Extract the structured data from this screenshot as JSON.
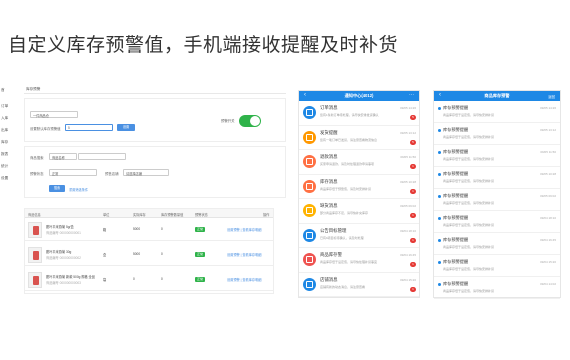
{
  "headline": "自定义库存预警值，手机端接收提醒及时补货",
  "desktop": {
    "left_nav": [
      "首",
      "订单",
      "入库",
      "出库",
      "库存",
      "报表",
      "统计",
      "设置"
    ],
    "breadcrumb": "库存预警",
    "scope_select": "一件商品仓",
    "warn_value_label": "设置默认库存预警值",
    "warn_value_input": "5",
    "confirm_button": "设置",
    "toggle_label": "预警开关",
    "filter": {
      "keyword_label": "商品搜索",
      "keyword_select": "商品名称",
      "status_label": "预警状态",
      "status_select": "正常",
      "store_label": "预售店铺",
      "store_select": "请选择店铺",
      "search_button": "搜索",
      "reset_link": "重置筛选条件"
    },
    "table": {
      "headers": [
        "商品信息",
        "单位",
        "实际库存",
        "库存预警数量值",
        "预警状态",
        "操作"
      ],
      "rows": [
        {
          "name": "脱叶平米燕菊 5g/盒",
          "code": "商品编号 000000000001",
          "unit": "箱",
          "stock": "5000",
          "warn": "0",
          "status": "正常",
          "ops": "设置预警 | 查看库存明细"
        },
        {
          "name": "脱叶平米燕菊 30g",
          "code": "商品编号 000000000002",
          "unit": "盒",
          "stock": "5000",
          "warn": "0",
          "status": "正常",
          "ops": "设置预警 | 查看库存明细"
        },
        {
          "name": "脱叶平米燕菊 新款 500g 规格 全品",
          "code": "商品编号 000000000003",
          "unit": "袋",
          "stock": "0",
          "warn": "0",
          "status": "正常",
          "ops": "设置预警 | 查看库存明细"
        }
      ]
    }
  },
  "phone1": {
    "title": "通知中心(4012)",
    "back": "‹",
    "more": "···",
    "items": [
      {
        "title": "订单消息",
        "text": "您有1条新订单待处理，请尽快安排发货确认",
        "time": "09/05 14:26",
        "badge": "5",
        "color": "#1e88e5"
      },
      {
        "title": "发货提醒",
        "text": "您有一笔订单已发货，请注意查看物流信息",
        "time": "09/05 13:12",
        "badge": "5",
        "color": "#ff9800"
      },
      {
        "title": "退款消息",
        "text": "买家申请退款，请及时处理退款申请事项",
        "time": "09/05 11:50",
        "badge": "1",
        "color": "#ff7043"
      },
      {
        "title": "库存消息",
        "text": "商品库存低于预警值，请及时安排补货",
        "time": "09/05 10:28",
        "badge": "1",
        "color": "#ff7043"
      },
      {
        "title": "缺货消息",
        "text": "部分商品库存不足，请尽快补充库存",
        "time": "09/05 09:02",
        "badge": "1",
        "color": "#ffb300"
      },
      {
        "title": "公告目标管理",
        "text": "已有9项目标待确认，请及时处理",
        "time": "09/04 18:10",
        "badge": "1",
        "color": "#1e88e5"
      },
      {
        "title": "商品库存警",
        "text": "商品库存低于设定值，请尽快处理补货事宜",
        "time": "09/04 16:45",
        "badge": "1",
        "color": "#ef5350"
      },
      {
        "title": "店铺消息",
        "text": "店铺有新的动态消息，请注意查看",
        "time": "09/04 15:20",
        "badge": "1",
        "color": "#1e88e5"
      }
    ]
  },
  "phone2": {
    "title": "商品库存预警",
    "back": "‹",
    "action": "返回",
    "items": [
      {
        "title": "库存预警提醒",
        "text": "商品库存低于设定值，请尽快安排补货",
        "time": "09/05 14:26"
      },
      {
        "title": "库存预警提醒",
        "text": "商品库存低于设定值，请尽快安排补货",
        "time": "09/05 13:12"
      },
      {
        "title": "库存预警提醒",
        "text": "商品库存低于设定值，请尽快安排补货",
        "time": "09/05 11:50"
      },
      {
        "title": "库存预警提醒",
        "text": "商品库存低于设定值，请尽快安排补货",
        "time": "09/05 10:28"
      },
      {
        "title": "库存预警提醒",
        "text": "商品库存低于设定值，请尽快安排补货",
        "time": "09/05 09:02"
      },
      {
        "title": "库存预警提醒",
        "text": "商品库存低于设定值，请尽快安排补货",
        "time": "09/04 18:10"
      },
      {
        "title": "库存预警提醒",
        "text": "商品库存低于设定值，请尽快安排补货",
        "time": "09/04 16:45"
      },
      {
        "title": "库存预警提醒",
        "text": "商品库存低于设定值，请尽快安排补货",
        "time": "09/04 15:20"
      },
      {
        "title": "库存预警提醒",
        "text": "商品库存低于设定值，请尽快安排补货",
        "time": "09/04 14:02"
      }
    ]
  }
}
